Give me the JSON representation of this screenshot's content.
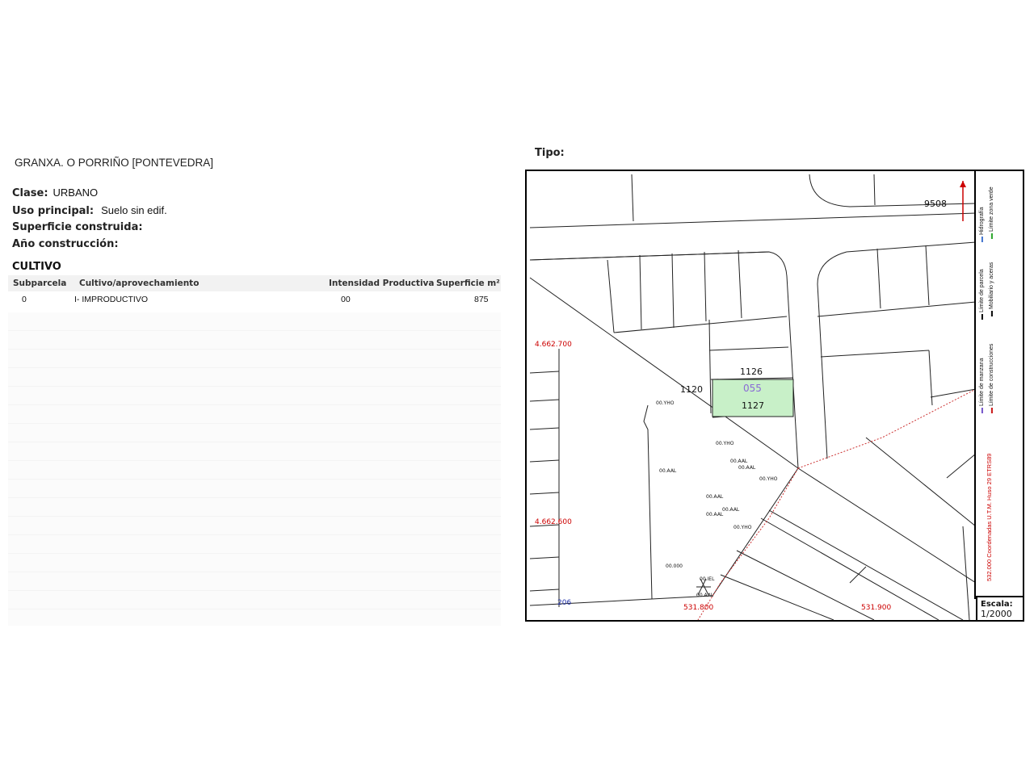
{
  "property": {
    "location": "GRANXA. O PORRIÑO [PONTEVEDRA]",
    "clase_label": "Clase:",
    "clase_value": "URBANO",
    "uso_label": "Uso principal:",
    "uso_value": "Suelo sin edif.",
    "superficie_label": "Superficie construida:",
    "anio_label": "Año construcción:"
  },
  "cultivo": {
    "title": "CULTIVO",
    "headers": [
      "Subparcela",
      "Cultivo/aprovechamiento",
      "Intensidad Productiva",
      "Superficie m²"
    ],
    "rows": [
      [
        "0",
        "I- IMPRODUCTIVO",
        "00",
        "875"
      ]
    ]
  },
  "map": {
    "tipo_label": "Tipo:",
    "parcel_numbers": [
      "9508",
      "1126",
      "055",
      "1127",
      "1120"
    ],
    "coordinates": [
      "4.662.700",
      "4.662.600",
      "531.800",
      "531.900",
      "206"
    ],
    "land_codes": [
      "00.YHO",
      "00.YHO",
      "00.AAL",
      "00.AAL",
      "00.YHO",
      "00.AAL",
      "00.AAL",
      "00.AAL",
      "00.AAL",
      "00.YHO",
      "00.000",
      "00.IEL",
      "00.AAL"
    ],
    "legend": [
      "Límite de manzana",
      "Límite de parcela",
      "Hidrografía",
      "Límite de construcciones",
      "Mobiliario y aceras",
      "Límite zona verde"
    ],
    "projection": "532.000 Coordenadas U.T.M. Huso 29 ETRS89",
    "scale_label": "Escala:",
    "scale_value": "1/2000",
    "highlight_color": "#c8f0c8",
    "legend_colors": {
      "manzana": "#7a5ccc",
      "parcela": "#000000",
      "hidrografia": "#4a7ad0",
      "construcciones": "#cc2222",
      "mobiliario": "#222222",
      "zona_verde": "#33aa33"
    }
  }
}
